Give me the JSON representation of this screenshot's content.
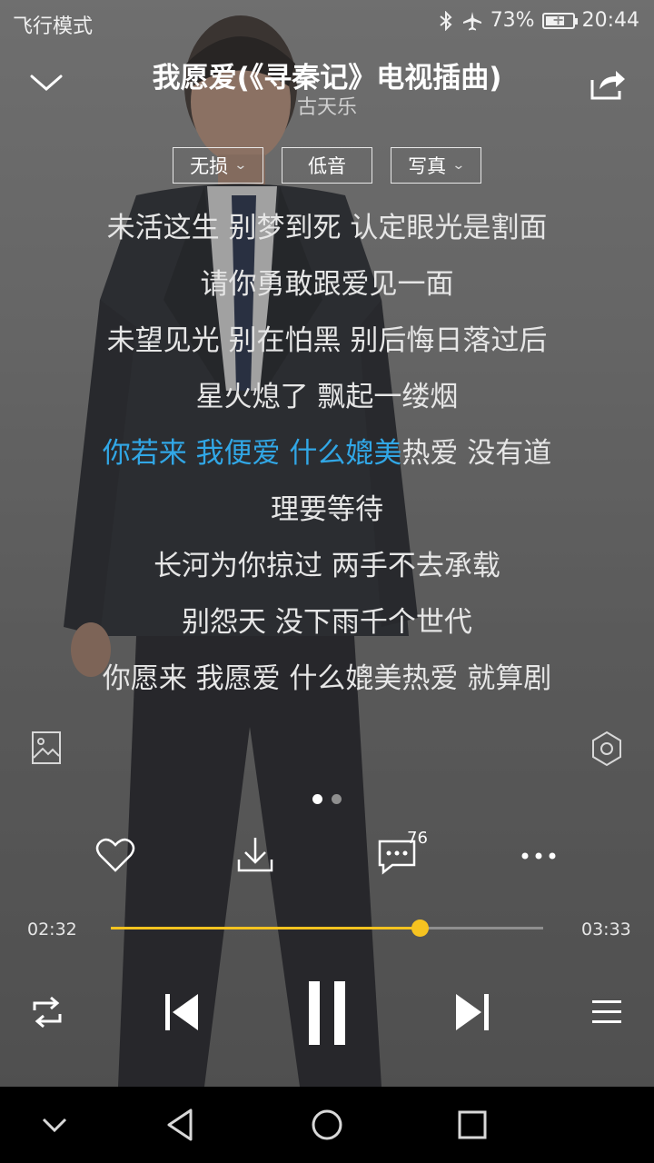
{
  "status_bar": {
    "mode": "飞行模式",
    "battery_percent": "73%",
    "battery_level": 0.73,
    "time": "20:44"
  },
  "header": {
    "title": "我愿爱(《寻秦记》电视插曲)",
    "artist": "古天乐"
  },
  "chips": [
    {
      "label": "无损",
      "has_dropdown": true
    },
    {
      "label": "低音",
      "has_dropdown": false
    },
    {
      "label": "写真",
      "has_dropdown": true
    }
  ],
  "lyrics": {
    "lines": [
      "未活这生 别梦到死 认定眼光是割面",
      "请你勇敢跟爱见一面",
      "未望见光 别在怕黑 别后悔日落过后",
      "星火熄了 飘起一缕烟"
    ],
    "current_played": "你若来 我便爱 什么媲美",
    "current_rest": "热爱 没有道",
    "lines_after": [
      "理要等待",
      "长河为你掠过 两手不去承载",
      "别怨天 没下雨千个世代",
      "你愿来 我愿爱 什么媲美热爱 就算剧"
    ]
  },
  "pager": {
    "pages": 2,
    "active": 0
  },
  "actions": {
    "comment_count": "76"
  },
  "player": {
    "elapsed": "02:32",
    "total": "03:33",
    "progress": 0.715
  },
  "colors": {
    "accent_progress": "#f6c320",
    "active_lyric": "#31a7e6"
  }
}
